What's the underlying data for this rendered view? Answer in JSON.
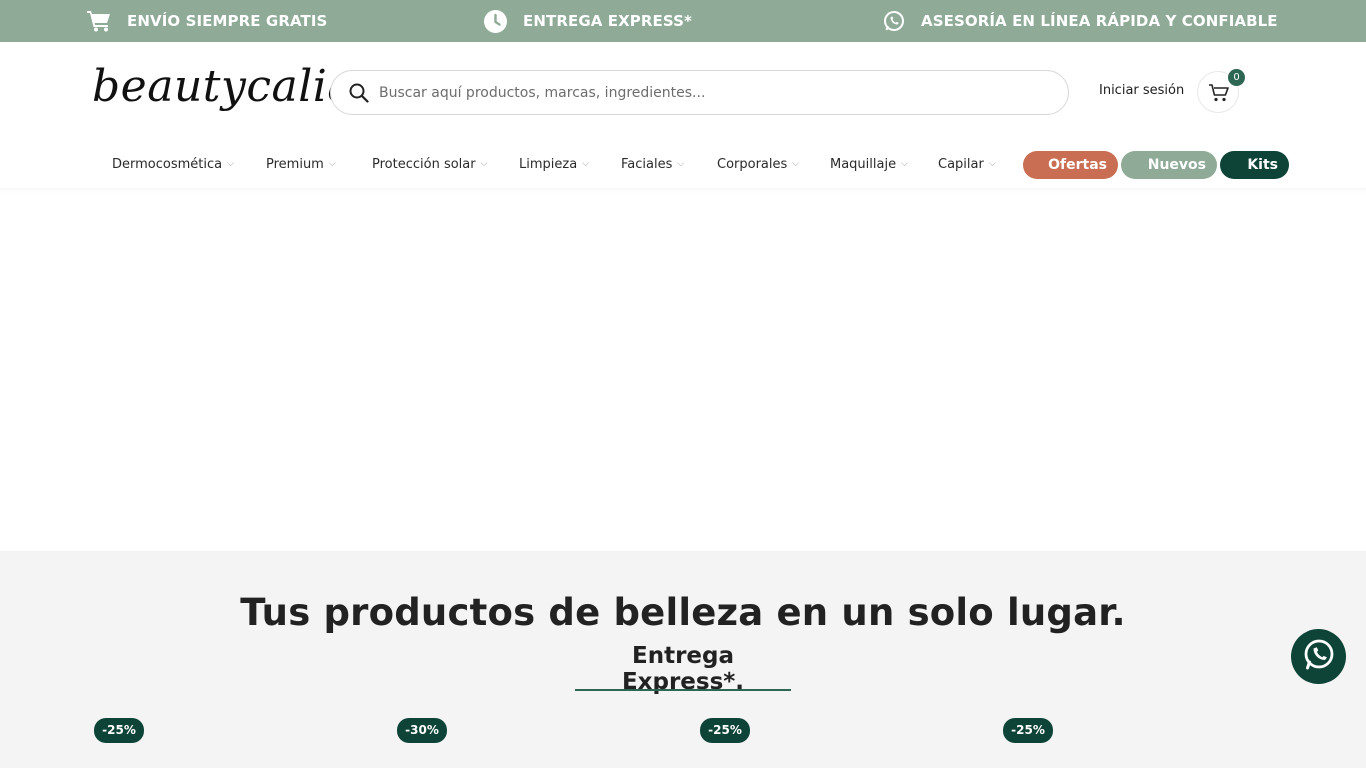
{
  "topbar": {
    "items": [
      {
        "icon": "cart-icon",
        "label": "ENVÍO SIEMPRE GRATIS"
      },
      {
        "icon": "clock-icon",
        "label": "ENTREGA EXPRESS*"
      },
      {
        "icon": "whatsapp-icon",
        "label": "ASESORÍA EN LÍNEA RÁPIDA Y CONFIABLE"
      }
    ]
  },
  "header": {
    "logo_text": "beautycalia",
    "search": {
      "placeholder": "Buscar aquí productos, marcas, ingredientes..."
    },
    "login_label": "Iniciar sesión",
    "cart_count": "0"
  },
  "nav": {
    "items": [
      {
        "label": "Dermocosmética"
      },
      {
        "label": "Premium"
      },
      {
        "label": "Protección solar"
      },
      {
        "label": "Limpieza"
      },
      {
        "label": "Faciales"
      },
      {
        "label": "Corporales"
      },
      {
        "label": "Maquillaje"
      },
      {
        "label": "Capilar"
      }
    ],
    "pills": {
      "ofertas": "Ofertas",
      "nuevos": "Nuevos",
      "kits": "Kits"
    }
  },
  "section": {
    "title": "Tus productos de belleza en un solo lugar.",
    "subtitle": "Entrega Express*.",
    "badges": [
      "-25%",
      "-30%",
      "-25%",
      "-25%"
    ]
  },
  "colors": {
    "topbar": "#8fab97",
    "ofertas": "#c96e52",
    "nuevos": "#8fab97",
    "kits": "#0e4437",
    "badge": "#0e4437",
    "section_bg": "#f4f4f4"
  }
}
